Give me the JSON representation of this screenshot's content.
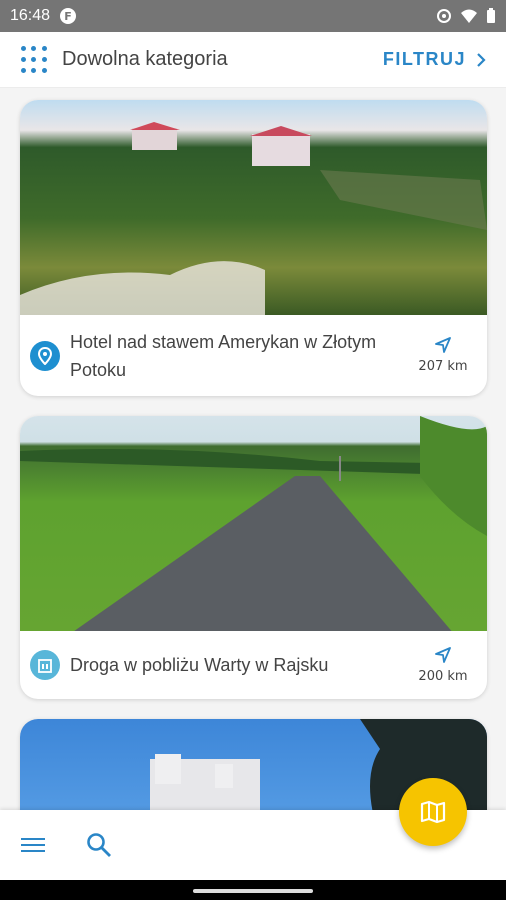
{
  "status_bar": {
    "time": "16:48",
    "app_badge": "F"
  },
  "header": {
    "category": "Dowolna kategoria",
    "filter_label": "FILTRUJ"
  },
  "cards": [
    {
      "title": "Hotel nad stawem Amerykan w Złotym Potoku",
      "distance": "207 km",
      "category_icon": "location-pin-icon",
      "icon_color": "#1e8fd0"
    },
    {
      "title": "Droga w pobliżu Warty w Rajsku",
      "distance": "200 km",
      "category_icon": "building-icon",
      "icon_color": "#58b6d9"
    }
  ],
  "colors": {
    "accent": "#2a86c7",
    "fab": "#f6c400"
  }
}
